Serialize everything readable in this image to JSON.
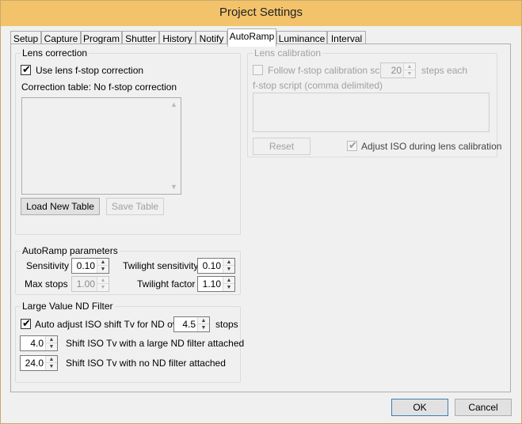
{
  "window": {
    "title": "Project Settings"
  },
  "tabs": [
    {
      "label": "Setup"
    },
    {
      "label": "Capture"
    },
    {
      "label": "Program"
    },
    {
      "label": "Shutter"
    },
    {
      "label": "History"
    },
    {
      "label": "Notify"
    },
    {
      "label": "AutoRamp"
    },
    {
      "label": "Luminance"
    },
    {
      "label": "Interval"
    }
  ],
  "lens_correction": {
    "title": "Lens correction",
    "use_checkbox_label": "Use lens f-stop correction",
    "use_checked": true,
    "table_label": "Correction table: No f-stop correction",
    "load_button": "Load New Table",
    "save_button": "Save Table"
  },
  "lens_calibration": {
    "title": "Lens calibration",
    "follow_label": "Follow f-stop calibration script",
    "follow_checked": false,
    "steps_value": "20",
    "steps_label": "steps each",
    "script_label": "f-stop script (comma delimited)",
    "reset_button": "Reset",
    "adjust_iso_label": "Adjust ISO during lens calibration",
    "adjust_iso_checked": true
  },
  "autoramp": {
    "title": "AutoRamp parameters",
    "sensitivity_label": "Sensitivity",
    "sensitivity_value": "0.10",
    "twilight_sensitivity_label": "Twilight sensitivity",
    "twilight_sensitivity_value": "0.10",
    "max_stops_label": "Max stops",
    "max_stops_value": "1.00",
    "twilight_factor_label": "Twilight factor",
    "twilight_factor_value": "1.10"
  },
  "nd_filter": {
    "title": "Large Value ND Filter",
    "auto_adjust_label": "Auto adjust ISO shift Tv for ND over",
    "auto_adjust_checked": true,
    "auto_adjust_value": "4.5",
    "stops_label": "stops",
    "large_nd_value": "4.0",
    "large_nd_label": "Shift ISO Tv with a large ND filter attached",
    "no_nd_value": "24.0",
    "no_nd_label": "Shift ISO Tv with no ND filter attached"
  },
  "footer": {
    "ok": "OK",
    "cancel": "Cancel"
  },
  "icons": {
    "check": "✔",
    "up": "▲",
    "down": "▼"
  }
}
